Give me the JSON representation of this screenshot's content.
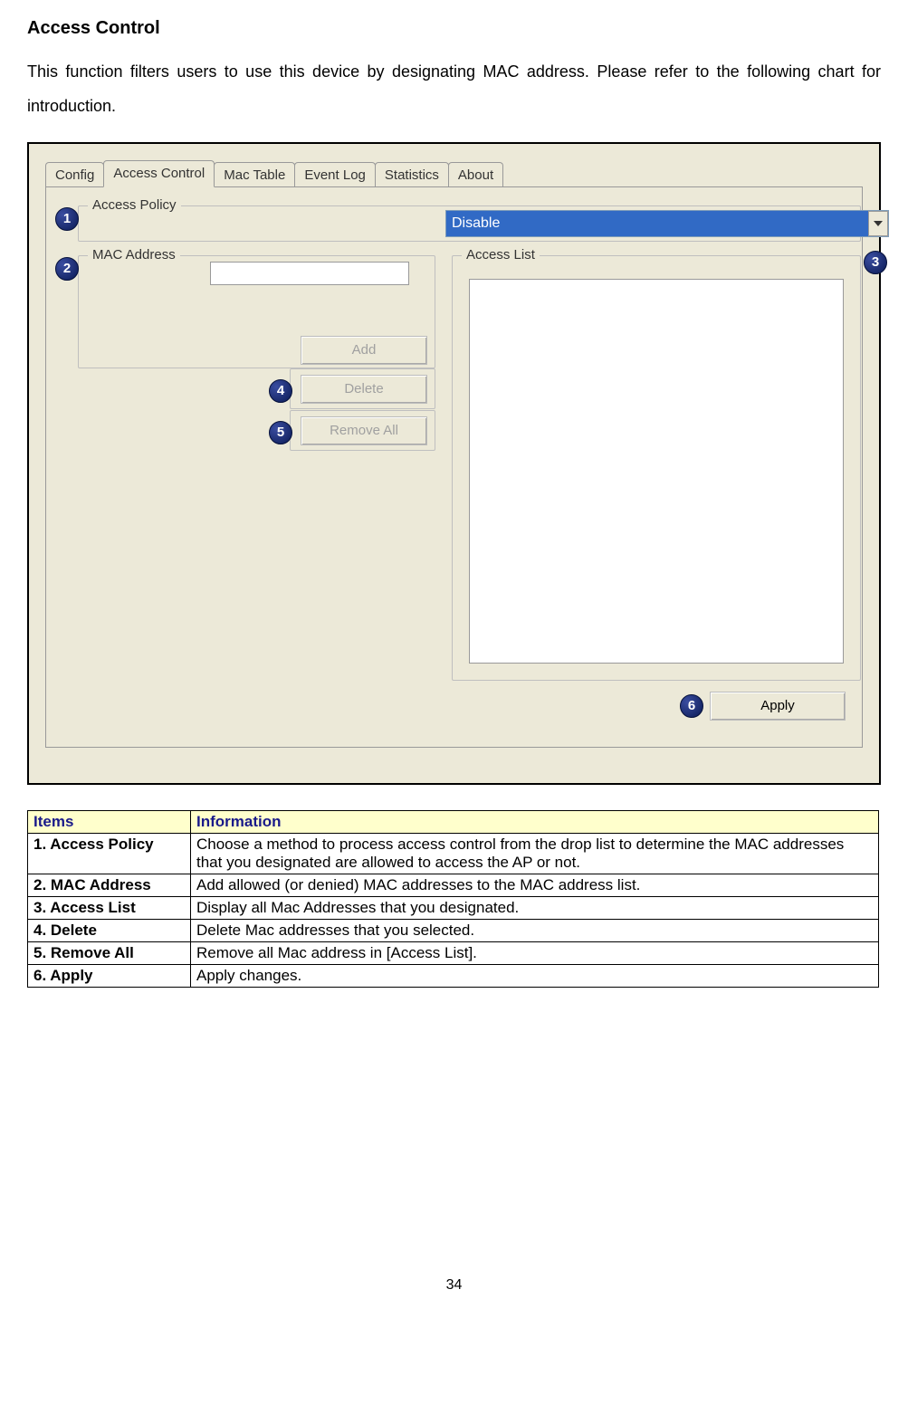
{
  "page": {
    "title": "Access Control",
    "intro": "This function filters users to use this device by designating MAC address. Please refer to the following chart for introduction.",
    "page_number": "34"
  },
  "ui": {
    "tabs": [
      "Config",
      "Access Control",
      "Mac Table",
      "Event Log",
      "Statistics",
      "About"
    ],
    "active_tab_index": 1,
    "policy": {
      "label": "Access Policy",
      "value": "Disable"
    },
    "mac": {
      "label": "MAC Address",
      "value": ""
    },
    "access_list": {
      "label": "Access List"
    },
    "buttons": {
      "add": "Add",
      "delete": "Delete",
      "remove_all": "Remove All",
      "apply": "Apply"
    },
    "callouts": {
      "c1": "1",
      "c2": "2",
      "c3": "3",
      "c4": "4",
      "c5": "5",
      "c6": "6"
    }
  },
  "table": {
    "headers": {
      "items": "Items",
      "info": "Information"
    },
    "rows": [
      {
        "item": "1. Access Policy",
        "info": "Choose a method to process access control from the drop list to determine the MAC addresses that you designated are allowed to access the AP or not."
      },
      {
        "item": "2. MAC Address",
        "info": "Add allowed (or denied) MAC addresses to the MAC address list."
      },
      {
        "item": "3. Access List",
        "info": "Display all Mac Addresses that you designated."
      },
      {
        "item": "4. Delete",
        "info": "Delete Mac addresses that you selected."
      },
      {
        "item": "5. Remove All",
        "info": "Remove all Mac address in [Access List]."
      },
      {
        "item": "6. Apply",
        "info": "Apply changes."
      }
    ]
  }
}
